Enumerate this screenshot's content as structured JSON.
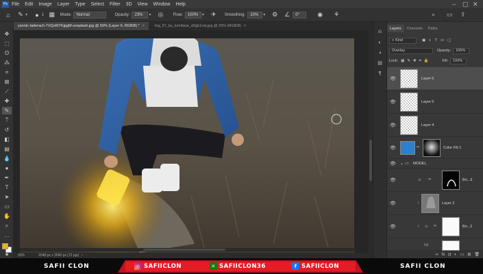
{
  "menu": {
    "logo": "Ps",
    "items": [
      "File",
      "Edit",
      "Image",
      "Layer",
      "Type",
      "Select",
      "Filter",
      "3D",
      "View",
      "Window",
      "Help"
    ]
  },
  "options": {
    "brush_size": "1",
    "mode_label": "Mode:",
    "mode_value": "Normal",
    "opacity_label": "Opacity:",
    "opacity_value": "23%",
    "flow_label": "Flow:",
    "flow_value": "100%",
    "smoothing_label": "Smoothing:",
    "smoothing_value": "10%",
    "angle_value": "0°"
  },
  "tabs": [
    {
      "label": "yannic-laderach-7VQoI6YKjpgM-unsplash.jpg @ 50% (Layer 6, RGB/8) *",
      "active": true
    },
    {
      "label": "fog_57_by_lumibear_d2gk1rmj.jpg @ 25% (RGB/8)",
      "active": false
    }
  ],
  "status": {
    "zoom": "50%",
    "doc_size": "2048 px x 2560 px (72 ppi)"
  },
  "panel": {
    "tabs": [
      "Layers",
      "Channels",
      "Paths"
    ],
    "kind_label": "Kind",
    "blend_mode": "Overlay",
    "opacity_label": "Opacity:",
    "opacity_value": "100%",
    "lock_label": "Lock:",
    "fill_label": "Fill:",
    "fill_value": "100%",
    "layers": [
      {
        "name": "Layer 6",
        "selected": true
      },
      {
        "name": "Layer 5",
        "selected": false
      },
      {
        "name": "Layer 4",
        "selected": false
      },
      {
        "name": "Color Fill 1",
        "selected": false
      },
      {
        "name": "MODEL",
        "selected": false
      },
      {
        "name": "Bri...3",
        "selected": false
      },
      {
        "name": "Layer 2",
        "selected": false
      },
      {
        "name": "Bri...2",
        "selected": false
      }
    ],
    "footer_fx": "fx"
  },
  "banner": {
    "left_name": "SAFII CLON",
    "instagram": "SAFIICLON",
    "xbox": "SAFIICLON36",
    "facebook": "SAFIICLON",
    "right_name": "SAFII CLON"
  },
  "colors": {
    "accent_red": "#e41c26",
    "foreground_swatch": "#f0b500",
    "background_swatch": "#ffffff",
    "color_fill_layer": "#2d7fd0"
  }
}
